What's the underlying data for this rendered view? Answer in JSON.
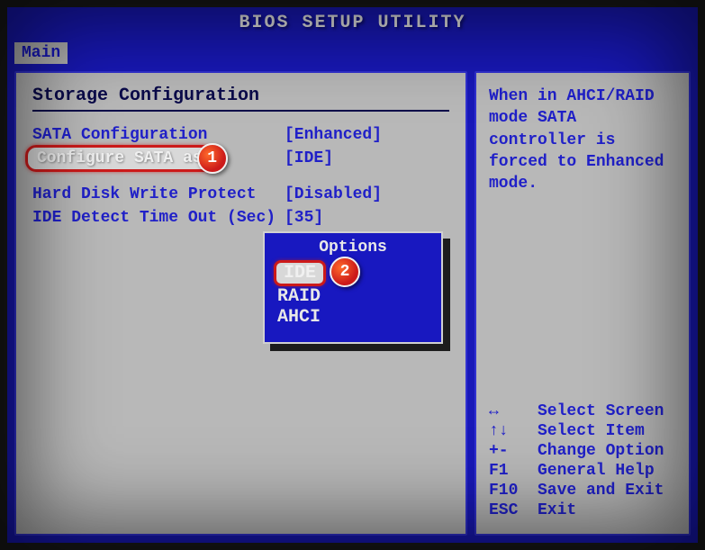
{
  "title": "BIOS SETUP UTILITY",
  "menu": {
    "main": "Main"
  },
  "section": {
    "title": "Storage Configuration"
  },
  "rows": {
    "sata_config": {
      "label": "SATA Configuration",
      "value": "[Enhanced]"
    },
    "configure_sata_as": {
      "label": "Configure SATA as",
      "value": "[IDE]"
    },
    "hd_write_protect": {
      "label": "Hard Disk Write Protect",
      "value": "[Disabled]"
    },
    "ide_detect_timeout": {
      "label": "IDE Detect Time Out (Sec)",
      "value": "[35]"
    }
  },
  "popup": {
    "title": "Options",
    "items": {
      "ide": "IDE",
      "raid": "RAID",
      "ahci": "AHCI"
    }
  },
  "help": {
    "text": "When in AHCI/RAID mode SATA controller is forced to Enhanced mode."
  },
  "keys": {
    "select_screen": {
      "k": "↔",
      "t": "Select Screen"
    },
    "select_item": {
      "k": "↑↓",
      "t": "Select Item"
    },
    "change_option": {
      "k": "+-",
      "t": "Change Option"
    },
    "general_help": {
      "k": "F1",
      "t": "General Help"
    },
    "save_exit": {
      "k": "F10",
      "t": "Save and Exit"
    },
    "exit": {
      "k": "ESC",
      "t": "Exit"
    }
  },
  "markers": {
    "one": "1",
    "two": "2"
  }
}
